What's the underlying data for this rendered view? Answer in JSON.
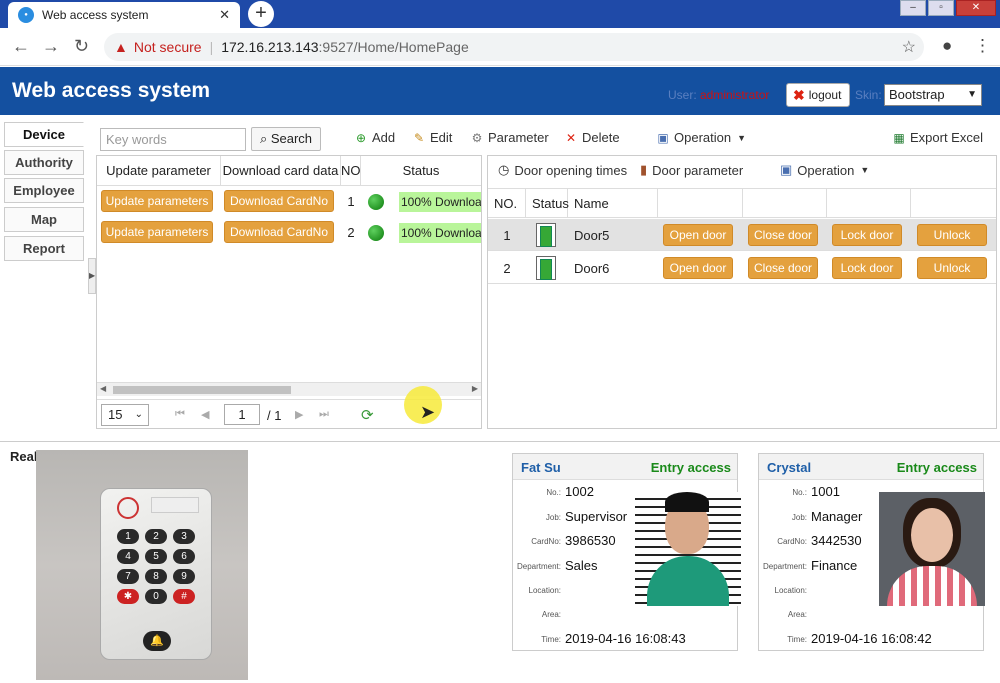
{
  "browser": {
    "tab_title": "Web access system",
    "not_secure": "Not secure",
    "url_host": "172.16.213.143",
    "url_path": ":9527/Home/HomePage"
  },
  "app": {
    "title": "Web access system",
    "user_label": "User:",
    "user_name": "administrator",
    "logout": "logout",
    "skin_label": "Skin:",
    "skin_value": "Bootstrap"
  },
  "nav": [
    "Device",
    "Authority",
    "Employee",
    "Map",
    "Report"
  ],
  "toolbar": {
    "keywords_placeholder": "Key words",
    "search": "Search",
    "add": "Add",
    "edit": "Edit",
    "parameter": "Parameter",
    "delete": "Delete",
    "operation": "Operation",
    "export": "Export Excel"
  },
  "device_grid": {
    "headers": [
      "Update parameter",
      "Download card data",
      "NO",
      "Status"
    ],
    "rows": [
      {
        "update": "Update parameters",
        "download": "Download CardNo",
        "no": "1",
        "status": "100% Download"
      },
      {
        "update": "Update parameters",
        "download": "Download CardNo",
        "no": "2",
        "status": "100% Download"
      }
    ],
    "page_size": "15",
    "page": "1",
    "page_of": "/ 1"
  },
  "door_panel": {
    "toolbar": {
      "times": "Door opening times",
      "param": "Door parameter",
      "operation": "Operation"
    },
    "headers": [
      "NO.",
      "Status",
      "Name"
    ],
    "rows": [
      {
        "no": "1",
        "name": "Door5"
      },
      {
        "no": "2",
        "name": "Door6"
      }
    ],
    "actions": [
      "Open door",
      "Close door",
      "Lock door",
      "Unlock"
    ]
  },
  "realtime_label": "Real",
  "keypad_keys": [
    "1",
    "2",
    "3",
    "4",
    "5",
    "6",
    "7",
    "8",
    "9",
    "✱",
    "0",
    "#"
  ],
  "cards": [
    {
      "name": "Fat Su",
      "status": "Entry access",
      "labels": [
        "No.:",
        "Job:",
        "CardNo:",
        "Department:",
        "Location:",
        "Area:",
        "Time:"
      ],
      "values": [
        "1002",
        "Supervisor",
        "3986530",
        "Sales",
        "",
        "",
        "2019-04-16 16:08:43"
      ]
    },
    {
      "name": "Crystal",
      "status": "Entry access",
      "labels": [
        "No.:",
        "Job:",
        "CardNo:",
        "Department:",
        "Location:",
        "Area:",
        "Time:"
      ],
      "values": [
        "1001",
        "Manager",
        "3442530",
        "Finance",
        "",
        "",
        "2019-04-16 16:08:42"
      ]
    }
  ]
}
